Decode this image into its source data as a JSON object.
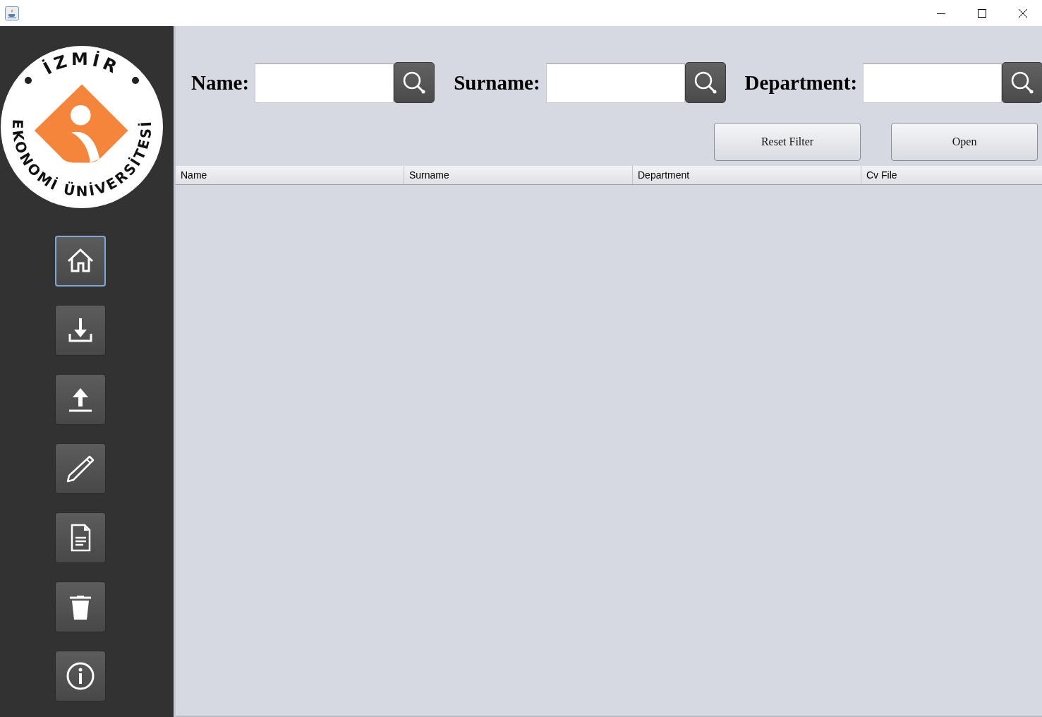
{
  "logo": {
    "top_text": "İZMİR",
    "bottom_text": "EKONOMİ ÜNİVERSİTESİ"
  },
  "sidebar": {
    "buttons": [
      {
        "kind": "home",
        "selected": true
      },
      {
        "kind": "download",
        "selected": false
      },
      {
        "kind": "upload",
        "selected": false
      },
      {
        "kind": "edit",
        "selected": false
      },
      {
        "kind": "document",
        "selected": false
      },
      {
        "kind": "delete",
        "selected": false
      },
      {
        "kind": "info",
        "selected": false
      }
    ]
  },
  "filters": [
    {
      "label": "Name:"
    },
    {
      "label": "Surname:"
    },
    {
      "label": "Department:"
    }
  ],
  "buttons": [
    "Reset Filter",
    "Open"
  ],
  "table": {
    "columns": [
      "Name",
      "Surname",
      "Department",
      "Cv File"
    ]
  }
}
